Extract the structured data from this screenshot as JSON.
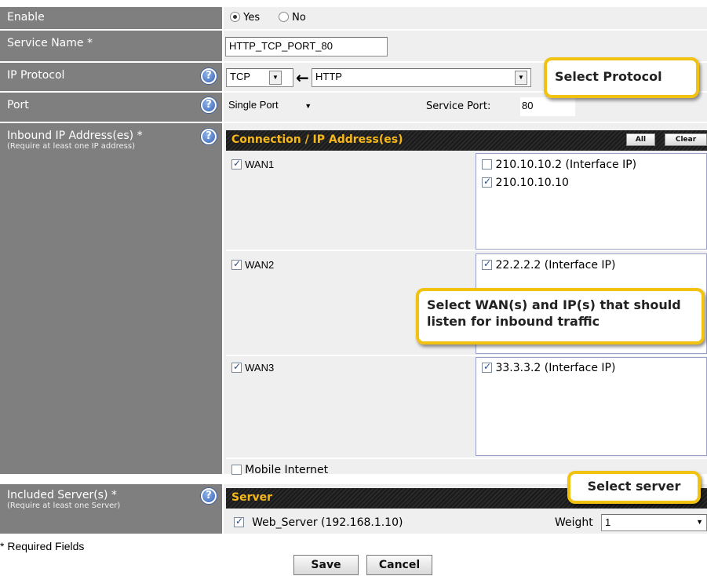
{
  "enable": {
    "label": "Enable",
    "yes": "Yes",
    "no": "No",
    "selected": "Yes"
  },
  "service_name": {
    "label": "Service Name *",
    "value": "HTTP_TCP_PORT_80"
  },
  "ip_protocol": {
    "label": "IP Protocol",
    "protocol": "TCP",
    "arrow": "←",
    "service": "HTTP"
  },
  "port": {
    "label": "Port",
    "type": "Single Port",
    "service_port_label": "Service Port:",
    "service_port_value": "80"
  },
  "inbound": {
    "label": "Inbound IP Address(es) *",
    "sub_label": "(Require at least one IP address)",
    "header": "Connection / IP Address(es)",
    "all_button": "All",
    "clear_button": "Clear",
    "wans": [
      {
        "name": "WAN1",
        "checked": true,
        "ips": [
          {
            "text": "210.10.10.2 (Interface IP)",
            "checked": false
          },
          {
            "text": "210.10.10.10",
            "checked": true
          }
        ]
      },
      {
        "name": "WAN2",
        "checked": true,
        "ips": [
          {
            "text": "22.2.2.2 (Interface IP)",
            "checked": true
          }
        ]
      },
      {
        "name": "WAN3",
        "checked": true,
        "ips": [
          {
            "text": "33.3.3.2 (Interface IP)",
            "checked": true
          }
        ]
      }
    ],
    "mobile": {
      "name": "Mobile Internet",
      "checked": false
    }
  },
  "included_servers": {
    "label": "Included Server(s) *",
    "sub_label": "(Require at least one Server)",
    "header": "Server",
    "server": {
      "name": "Web_Server (192.168.1.10)",
      "checked": true
    },
    "weight_label": "Weight",
    "weight_value": "1"
  },
  "required_note": "* Required Fields",
  "buttons": {
    "save": "Save",
    "cancel": "Cancel"
  },
  "callouts": {
    "protocol": "Select Protocol",
    "wan": "Select WAN(s) and IP(s) that should listen for inbound traffic",
    "server": "Select server"
  },
  "colors": {
    "label_bg": "#7f7f7f",
    "field_bg": "#efefef",
    "header_text": "#f6b81a",
    "callout_border": "#f2c211",
    "help_icon": "#3563b7"
  }
}
